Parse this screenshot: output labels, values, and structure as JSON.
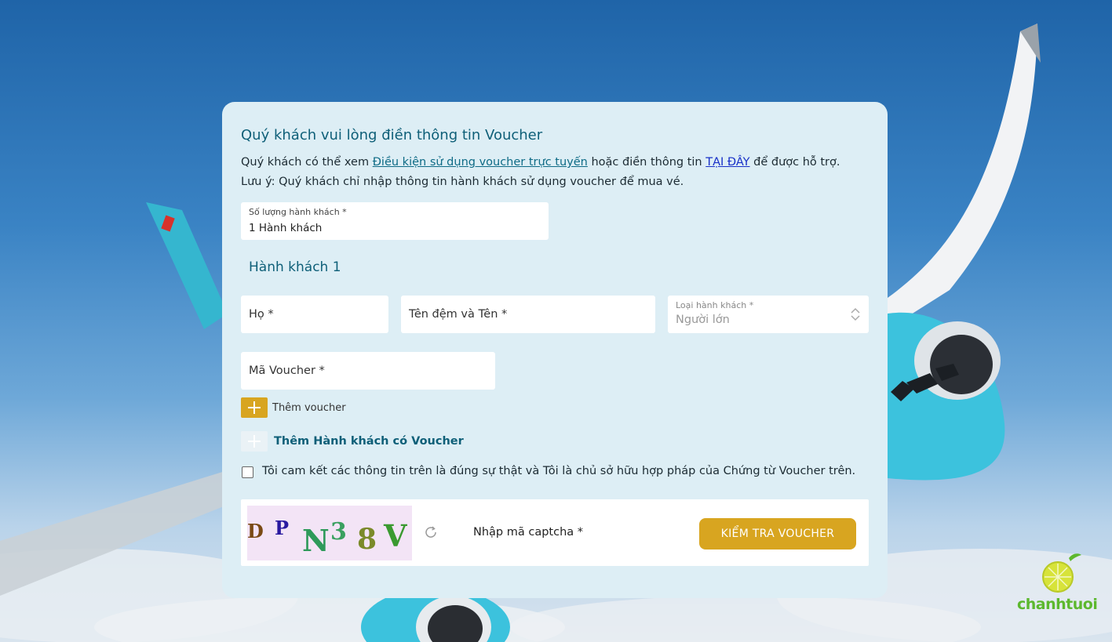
{
  "form": {
    "title": "Quý khách vui lòng điền thông tin Voucher",
    "intro_prefix": "Quý khách có thể xem ",
    "intro_link": "Điều kiện sử dụng voucher trực tuyến",
    "intro_middle": " hoặc điền thông tin ",
    "intro_here": "TẠI ĐÂY",
    "intro_suffix": " để được hỗ trợ.",
    "note": "Lưu ý: Quý khách chỉ nhập thông tin hành khách sử dụng voucher để mua vé.",
    "passenger_count": {
      "label": "Số lượng hành khách *",
      "value": "1 Hành khách"
    },
    "passenger_title": "Hành khách 1",
    "last_name_placeholder": "Họ *",
    "first_name_placeholder": "Tên đệm và Tên *",
    "passenger_type": {
      "label": "Loại hành khách *",
      "value": "Người lớn"
    },
    "voucher_placeholder": "Mã Voucher *",
    "add_voucher": "Thêm voucher",
    "add_passenger": "Thêm Hành khách có Voucher",
    "commit_text": "Tôi cam kết các thông tin trên là đúng sự thật và Tôi là chủ sở hữu hợp pháp của Chứng từ Voucher trên.",
    "captcha_chars": [
      "D",
      "P",
      "N",
      "3",
      "8",
      "V"
    ],
    "captcha_placeholder": "Nhập mã captcha *",
    "check_button": "KIỂM TRA VOUCHER"
  },
  "logo": {
    "text": "chanhtuoi"
  },
  "colors": {
    "accent_gold": "#d8a520",
    "title_teal": "#0e5f78",
    "card_bg": "#ddeef5"
  }
}
